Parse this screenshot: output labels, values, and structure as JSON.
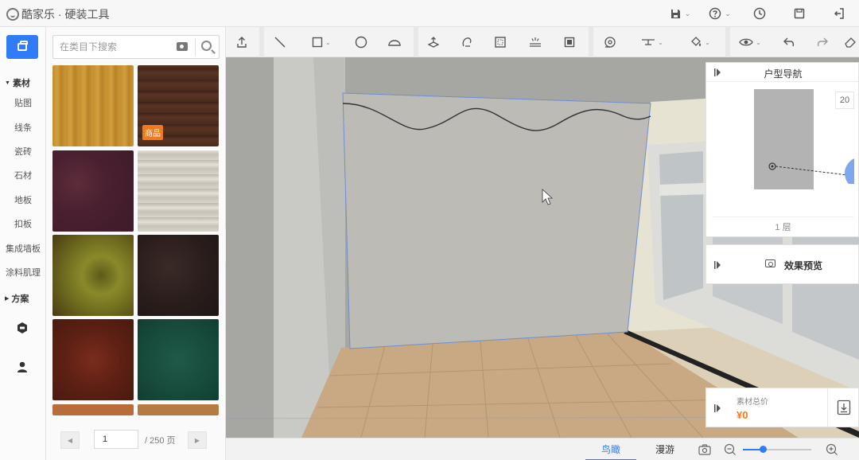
{
  "app": {
    "title": "酷家乐 · 硬装工具"
  },
  "sidebar": {
    "sections": [
      {
        "label": "素材"
      },
      {
        "label": "方案"
      }
    ],
    "items": [
      {
        "label": "贴图"
      },
      {
        "label": "线条"
      },
      {
        "label": "瓷砖"
      },
      {
        "label": "石材"
      },
      {
        "label": "地板"
      },
      {
        "label": "扣板"
      },
      {
        "label": "集成墙板"
      },
      {
        "label": "涂料肌理"
      }
    ]
  },
  "search": {
    "placeholder": "在类目下搜索"
  },
  "materials": {
    "badge": "商品"
  },
  "pagination": {
    "current": "1",
    "total_label": "/ 250 页"
  },
  "nav_panel": {
    "title": "户型导航",
    "number": "20",
    "floor": "1 层"
  },
  "preview_panel": {
    "label": "效果预览"
  },
  "price_panel": {
    "label": "素材总价",
    "value": "¥0"
  },
  "view_tabs": [
    {
      "label": "鸟瞰",
      "active": true
    },
    {
      "label": "漫游",
      "active": false
    }
  ],
  "zoom": {
    "level": 0.3
  },
  "colors": {
    "accent": "#2f7cf6",
    "badge": "#f07b1e",
    "price": "#f07b1e"
  }
}
